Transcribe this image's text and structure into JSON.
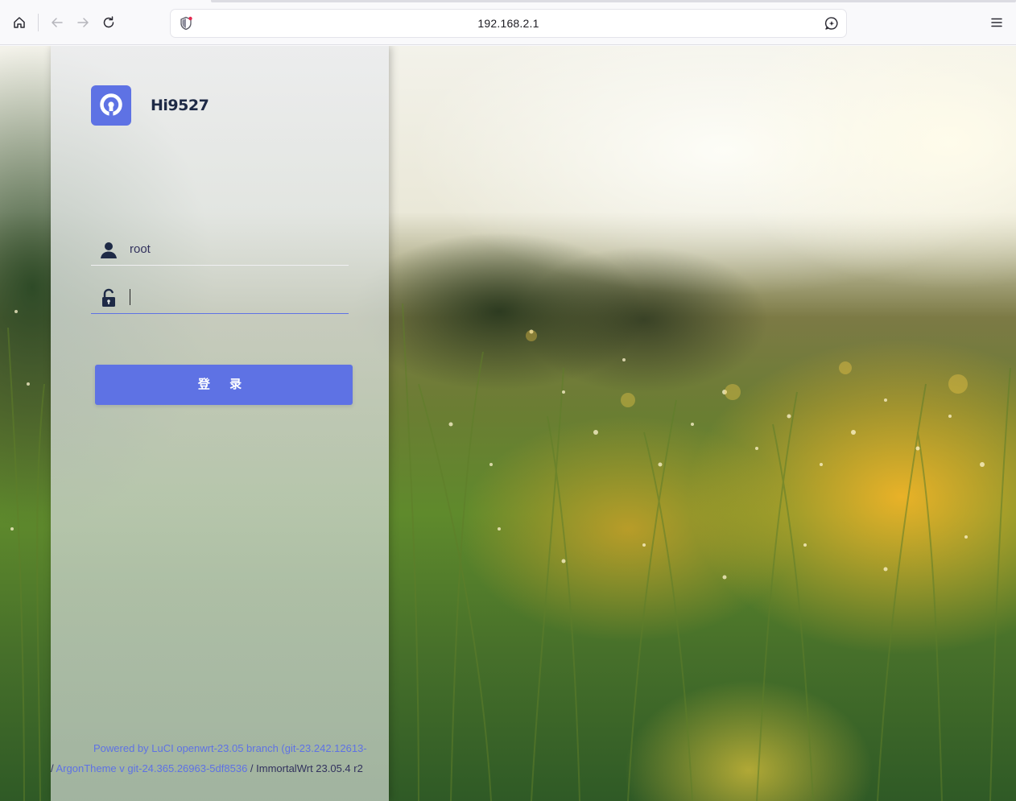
{
  "browser": {
    "url": "192.168.2.1",
    "icons": {
      "home": "home-icon",
      "back": "arrow-left-icon",
      "forward": "arrow-right-icon",
      "reload": "reload-icon",
      "security": "shield-icon",
      "url_action": "chat-icon",
      "menu": "hamburger-menu-icon"
    }
  },
  "login": {
    "brand_name": "Hi9527",
    "username_value": "root",
    "password_value": "",
    "submit_label": "登 录",
    "accent_color": "#5e72e4"
  },
  "footer": {
    "powered_by": "Powered by LuCI openwrt-23.05 branch (git-23.242.12613-",
    "separator_lead": "/ ",
    "theme_link": "ArgonTheme v git-24.365.26963-5df8536",
    "separator": " / ",
    "firmware": "ImmortalWrt 23.05.4 r2"
  }
}
